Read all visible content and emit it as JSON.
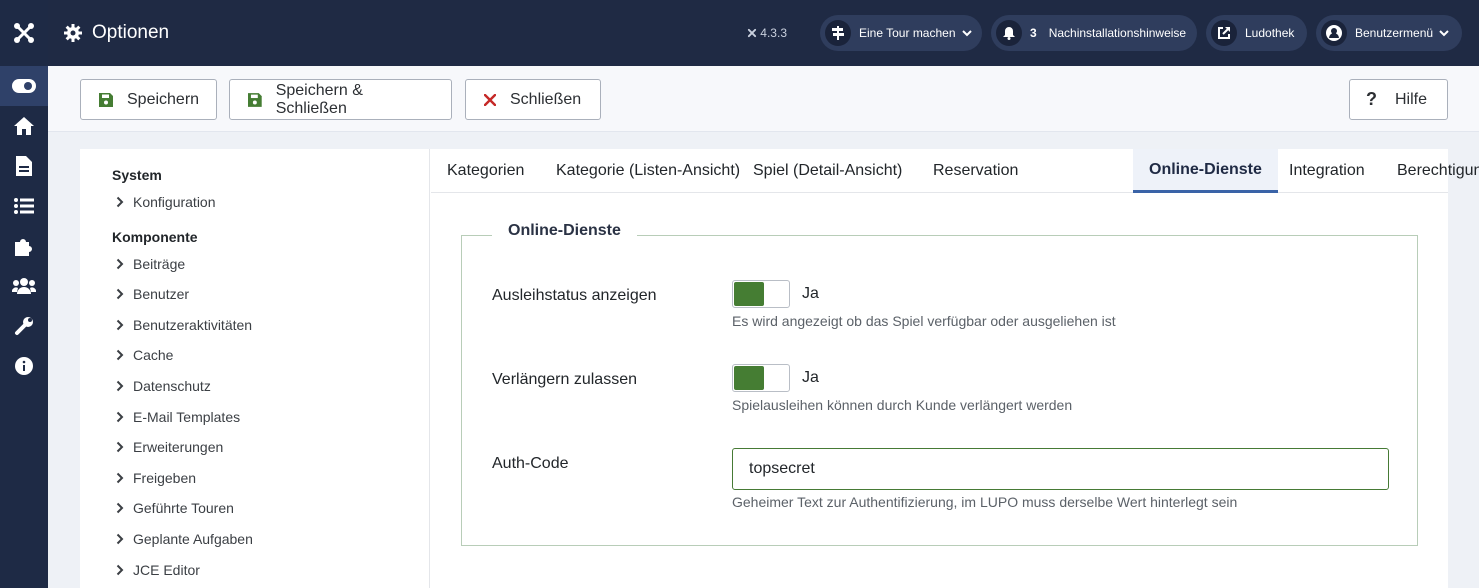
{
  "header": {
    "title": "Optionen",
    "version": "4.3.3",
    "buttons": {
      "tour": "Eine Tour machen",
      "notices_count": "3",
      "notices": "Nachinstallationshinweise",
      "site": "Ludothek",
      "user": "Benutzermenü"
    }
  },
  "sidebar": {
    "icons": [
      "joomla-logo-icon",
      "toggle-menu-icon",
      "home-icon",
      "content-icon",
      "menus-icon",
      "components-icon",
      "users-icon",
      "system-icon",
      "help-info-icon"
    ]
  },
  "toolbar": {
    "save_label": "Speichern",
    "save_close_label": "Speichern & Schließen",
    "close_label": "Schließen",
    "help_label": "Hilfe"
  },
  "nav": {
    "system_heading": "System",
    "system_items": [
      "Konfiguration"
    ],
    "component_heading": "Komponente",
    "component_items": [
      "Beiträge",
      "Benutzer",
      "Benutzeraktivitäten",
      "Cache",
      "Datenschutz",
      "E-Mail Templates",
      "Erweiterungen",
      "Freigeben",
      "Geführte Touren",
      "Geplante Aufgaben",
      "JCE Editor"
    ]
  },
  "tabs": [
    "Kategorien",
    "Kategorie (Listen-Ansicht)",
    "Spiel (Detail-Ansicht)",
    "Reservation",
    "Online-Dienste",
    "Integration",
    "Berechtigungen"
  ],
  "active_tab": "Online-Dienste",
  "form": {
    "legend": "Online-Dienste",
    "fields": [
      {
        "label": "Ausleihstatus anzeigen",
        "value": "Ja",
        "description": "Es wird angezeigt ob das Spiel verfügbar oder ausgeliehen ist"
      },
      {
        "label": "Verlängern zulassen",
        "value": "Ja",
        "description": "Spielausleihen können durch Kunde verlängert werden"
      },
      {
        "label": "Auth-Code",
        "value": "topsecret",
        "description": "Geheimer Text zur Authentifizierung, im LUPO muss derselbe Wert hinterlegt sein"
      }
    ]
  },
  "colors": {
    "header_bg": "#1f2a44",
    "sidebar_bg": "#1e2a45",
    "switch_on": "#457d33",
    "save_icon": "#457d33",
    "close_icon": "#c52827",
    "active_tab_border": "#3a63a7"
  }
}
